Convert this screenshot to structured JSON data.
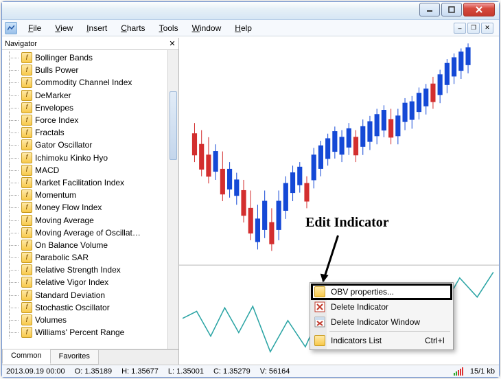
{
  "title_bar": {},
  "menu": {
    "items": [
      "File",
      "View",
      "Insert",
      "Charts",
      "Tools",
      "Window",
      "Help"
    ]
  },
  "navigator": {
    "title": "Navigator",
    "items": [
      "Bollinger Bands",
      "Bulls Power",
      "Commodity Channel Index",
      "DeMarker",
      "Envelopes",
      "Force Index",
      "Fractals",
      "Gator Oscillator",
      "Ichimoku Kinko Hyo",
      "MACD",
      "Market Facilitation Index",
      "Momentum",
      "Money Flow Index",
      "Moving Average",
      "Moving Average of Oscillat…",
      "On Balance Volume",
      "Parabolic SAR",
      "Relative Strength Index",
      "Relative Vigor Index",
      "Standard Deviation",
      "Stochastic Oscillator",
      "Volumes",
      "Williams' Percent Range"
    ],
    "tabs": {
      "common": "Common",
      "favorites": "Favorites",
      "active": "common"
    }
  },
  "chart_data": {
    "type": "candlestick+line",
    "note": "Upper pane candlestick price chart, lower pane OBV line indicator. Values estimated from status bar.",
    "ohlc_sample": {
      "date": "2013.09.19 00:00",
      "O": 1.35189,
      "H": 1.35677,
      "L": 1.35001,
      "C": 1.35279,
      "V": 56164
    }
  },
  "context_menu": {
    "items": [
      {
        "label": "OBV properties...",
        "icon": "gold",
        "highlighted": true
      },
      {
        "label": "Delete Indicator",
        "icon": "del"
      },
      {
        "label": "Delete Indicator Window",
        "icon": "del"
      },
      {
        "separator": true
      },
      {
        "label": "Indicators List",
        "icon": "gold",
        "shortcut": "Ctrl+I"
      }
    ]
  },
  "annotation": {
    "label": "Edit Indicator"
  },
  "status": {
    "datetime": "2013.09.19 00:00",
    "o_label": "O:",
    "o": "1.35189",
    "h_label": "H:",
    "h": "1.35677",
    "l_label": "L:",
    "l": "1.35001",
    "c_label": "C:",
    "c": "1.35279",
    "v_label": "V:",
    "v": "56164",
    "bandwidth": "15/1 kb"
  }
}
